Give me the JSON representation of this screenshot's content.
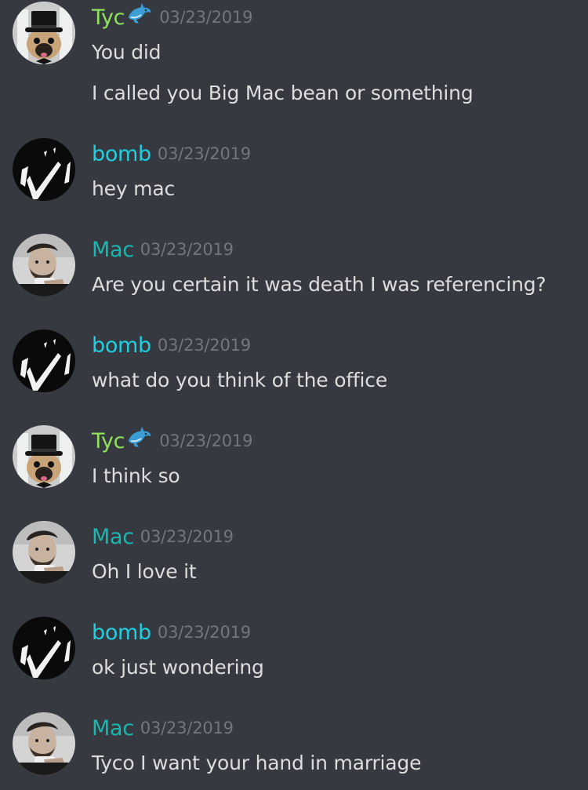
{
  "colors": {
    "background": "#36393f",
    "message_text": "#dcddde",
    "timestamp": "#72767d",
    "tyc": "#8fe35c",
    "bomb": "#1fcfe0",
    "mac": "#19b8b0"
  },
  "messages": [
    {
      "author": "Tyc",
      "author_icon": "dolphin-icon",
      "avatar_icon": "pug-top-hat-avatar",
      "timestamp": "03/23/2019",
      "lines": [
        "You did",
        "I called you Big Mac bean or something"
      ]
    },
    {
      "author": "bomb",
      "avatar_icon": "bomb-avatar",
      "timestamp": "03/23/2019",
      "lines": [
        "hey mac"
      ]
    },
    {
      "author": "Mac",
      "avatar_icon": "mac-avatar",
      "timestamp": "03/23/2019",
      "lines": [
        "Are you certain it was death I was referencing?"
      ]
    },
    {
      "author": "bomb",
      "avatar_icon": "bomb-avatar",
      "timestamp": "03/23/2019",
      "lines": [
        "what do you think of the office"
      ]
    },
    {
      "author": "Tyc",
      "author_icon": "dolphin-icon",
      "avatar_icon": "pug-top-hat-avatar",
      "timestamp": "03/23/2019",
      "lines": [
        "I think so"
      ]
    },
    {
      "author": "Mac",
      "avatar_icon": "mac-avatar",
      "timestamp": "03/23/2019",
      "lines": [
        "Oh I love it"
      ]
    },
    {
      "author": "bomb",
      "avatar_icon": "bomb-avatar",
      "timestamp": "03/23/2019",
      "lines": [
        "ok just wondering"
      ]
    },
    {
      "author": "Mac",
      "avatar_icon": "mac-avatar",
      "timestamp": "03/23/2019",
      "lines": [
        "Tyco I want your hand in marriage"
      ]
    }
  ]
}
